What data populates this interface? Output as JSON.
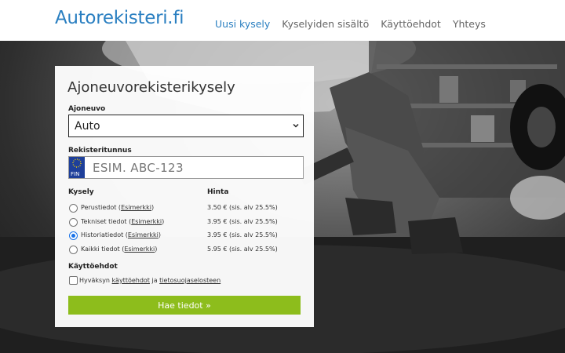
{
  "header": {
    "logo": "Autorekisteri.fi",
    "nav": [
      "Uusi kysely",
      "Kyselyiden sisältö",
      "Käyttöehdot",
      "Yhteys"
    ]
  },
  "form": {
    "title": "Ajoneuvorekisterikysely",
    "vehicle_label": "Ajoneuvo",
    "vehicle_value": "Auto",
    "plate_label": "Rekisteritunnus",
    "plate_country": "FIN",
    "plate_placeholder": "ESIM. ABC-123",
    "query_label": "Kysely",
    "price_label": "Hinta",
    "queries": [
      {
        "name": "Perustiedot",
        "example": "Esimerkki",
        "price": "3.50 € (sis. alv 25.5%)",
        "selected": false
      },
      {
        "name": "Tekniset tiedot",
        "example": "Esimerkki",
        "price": "3.95 € (sis. alv 25.5%)",
        "selected": false
      },
      {
        "name": "Historiatiedot",
        "example": "Esimerkki",
        "price": "3.95 € (sis. alv 25.5%)",
        "selected": true
      },
      {
        "name": "Kaikki tiedot",
        "example": "Esimerkki",
        "price": "5.95 € (sis. alv 25.5%)",
        "selected": false
      }
    ],
    "terms_label": "Käyttöehdot",
    "terms_text_pre": "Hyväksyn",
    "terms_link1": "käyttöehdot",
    "terms_text_mid": "ja",
    "terms_link2": "tietosuojaselosteen",
    "submit_label": "Hae tiedot »"
  },
  "colors": {
    "brand": "#2a7fc1",
    "submit": "#8dbd1c",
    "eu_band": "#1e3f9a"
  }
}
